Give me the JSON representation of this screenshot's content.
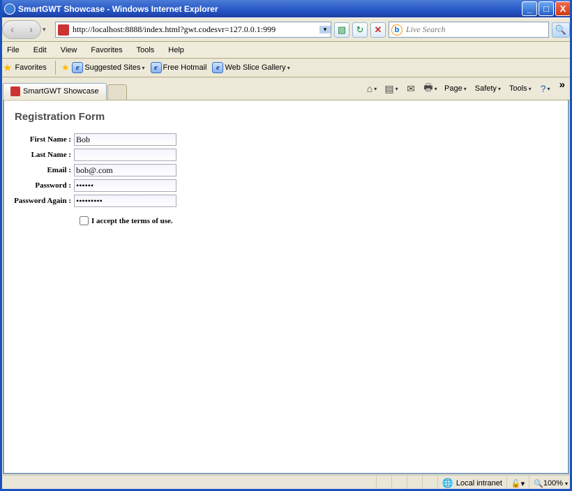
{
  "window": {
    "title": "SmartGWT Showcase - Windows Internet Explorer",
    "min": "_",
    "max": "□",
    "close": "X"
  },
  "nav": {
    "url": "http://localhost:8888/index.html?gwt.codesvr=127.0.0.1:999",
    "refresh": "↻",
    "stop": "✕",
    "searchPlaceholder": "Live Search",
    "searchIcon": "🔍"
  },
  "menu": {
    "file": "File",
    "edit": "Edit",
    "view": "View",
    "favorites": "Favorites",
    "tools": "Tools",
    "help": "Help"
  },
  "favbar": {
    "favorites": "Favorites",
    "suggested": "Suggested Sites",
    "hotmail": "Free Hotmail",
    "webslice": "Web Slice Gallery"
  },
  "tab": {
    "title": "SmartGWT Showcase"
  },
  "cmd": {
    "page": "Page",
    "safety": "Safety",
    "tools": "Tools"
  },
  "form": {
    "heading": "Registration Form",
    "first": {
      "label": "First Name :",
      "value": "Bob"
    },
    "last": {
      "label": "Last Name :",
      "value": ""
    },
    "email": {
      "label": "Email :",
      "value": "bob@.com"
    },
    "pwd": {
      "label": "Password :",
      "value": "••••••"
    },
    "pwd2": {
      "label": "Password Again :",
      "value": "•••••••••"
    },
    "terms": {
      "label": "I accept the terms of use."
    }
  },
  "status": {
    "zone": "Local intranet",
    "zoom": "100%"
  }
}
